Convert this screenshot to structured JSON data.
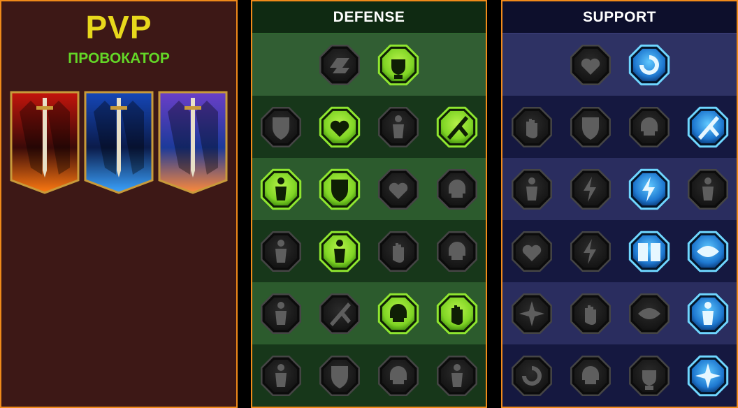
{
  "left": {
    "title": "PVP",
    "role": "ПРОВОКАТОР",
    "banners": [
      {
        "name": "red-banner",
        "colors": [
          "#ff7a12",
          "#c4150c",
          "#3a0a08"
        ]
      },
      {
        "name": "blue-banner",
        "colors": [
          "#3ba4ff",
          "#1547b8",
          "#0b1b4a"
        ]
      },
      {
        "name": "purple-banner",
        "colors": [
          "#ff8a3a",
          "#6a3fc8",
          "#1c3a9a"
        ]
      }
    ]
  },
  "defense": {
    "title": "DEFENSE",
    "accent": "#8fe630",
    "rows": [
      [
        {
          "icon": "shattered-floor-icon",
          "active": false
        },
        {
          "icon": "raised-fist-icon",
          "active": true
        }
      ],
      [
        {
          "icon": "shield-chevron-icon",
          "active": false
        },
        {
          "icon": "heart-vine-icon",
          "active": true
        },
        {
          "icon": "stone-golem-icon",
          "active": false
        },
        {
          "icon": "crossed-blades-icon",
          "active": true
        }
      ],
      [
        {
          "icon": "warrior-pair-icon",
          "active": true
        },
        {
          "icon": "shield-bearer-icon",
          "active": true
        },
        {
          "icon": "heart-skull-icon",
          "active": false
        },
        {
          "icon": "hooded-head-icon",
          "active": false
        }
      ],
      [
        {
          "icon": "crowd-icon",
          "active": false
        },
        {
          "icon": "alien-hourglass-icon",
          "active": true
        },
        {
          "icon": "open-palm-icon",
          "active": false
        },
        {
          "icon": "bull-head-icon",
          "active": false
        }
      ],
      [
        {
          "icon": "dash-runner-icon",
          "active": false
        },
        {
          "icon": "claw-marks-icon",
          "active": false
        },
        {
          "icon": "radiant-skull-icon",
          "active": true
        },
        {
          "icon": "hand-grab-icon",
          "active": true
        }
      ],
      [
        {
          "icon": "spiked-warrior-icon",
          "active": false
        },
        {
          "icon": "winged-shield-icon",
          "active": false
        },
        {
          "icon": "bearded-head-icon",
          "active": false
        },
        {
          "icon": "flexing-figure-icon",
          "active": false
        }
      ]
    ]
  },
  "support": {
    "title": "SUPPORT",
    "accent": "#6fd6ff",
    "rows": [
      [
        {
          "icon": "heart-plus-icon",
          "active": false
        },
        {
          "icon": "spiral-swirl-icon",
          "active": true
        }
      ],
      [
        {
          "icon": "praying-hands-icon",
          "active": false
        },
        {
          "icon": "dome-shield-icon",
          "active": false
        },
        {
          "icon": "smoke-skull-icon",
          "active": false
        },
        {
          "icon": "bleeding-cut-icon",
          "active": true
        }
      ],
      [
        {
          "icon": "sparkle-figure-icon",
          "active": false
        },
        {
          "icon": "lightning-bolt-icon",
          "active": false
        },
        {
          "icon": "electric-strike-icon",
          "active": true
        },
        {
          "icon": "shadow-pair-icon",
          "active": false
        }
      ],
      [
        {
          "icon": "chained-heart-icon",
          "active": false
        },
        {
          "icon": "comet-icon",
          "active": false
        },
        {
          "icon": "open-book-icon",
          "active": true
        },
        {
          "icon": "fierce-eyes-icon",
          "active": true
        }
      ],
      [
        {
          "icon": "compass-star-icon",
          "active": false
        },
        {
          "icon": "winged-boot-icon",
          "active": false
        },
        {
          "icon": "evil-eye-icon",
          "active": false
        },
        {
          "icon": "voodoo-doll-icon",
          "active": true
        }
      ],
      [
        {
          "icon": "potion-flask-icon",
          "active": false
        },
        {
          "icon": "grim-skull-icon",
          "active": false
        },
        {
          "icon": "iron-fist-icon",
          "active": false
        },
        {
          "icon": "eagle-head-icon",
          "active": true
        }
      ]
    ]
  }
}
